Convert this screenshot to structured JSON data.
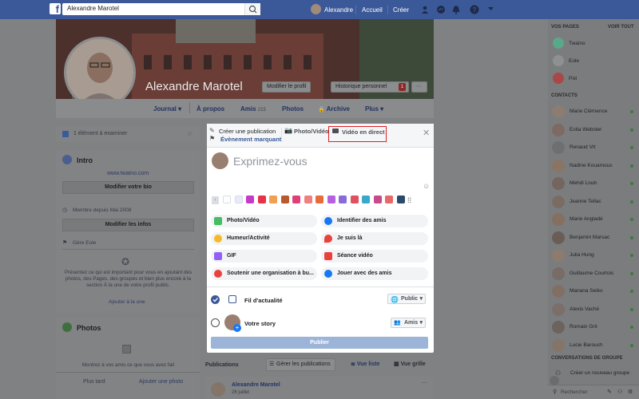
{
  "topbar": {
    "search_value": "Alexandre Marotel",
    "user_name": "Alexandre",
    "home": "Accueil",
    "create": "Créer"
  },
  "cover": {
    "name": "Alexandre Marotel",
    "edit_profile": "Modifier le profil",
    "history": "Historique personnel",
    "history_badge": "1",
    "more": "···"
  },
  "profile_nav": {
    "items": [
      {
        "label": "Journal"
      },
      {
        "label": "À propos"
      },
      {
        "label": "Amis",
        "count": "215"
      },
      {
        "label": "Photos"
      },
      {
        "label": "Archive"
      },
      {
        "label": "Plus"
      }
    ]
  },
  "left": {
    "review": "1 élément à examiner",
    "intro_title": "Intro",
    "intro_link": "www.twaino.com",
    "edit_bio": "Modifier votre bio",
    "member_since": "Membre depuis Mai 2008",
    "edit_info": "Modifier les infos",
    "manages": "Gère Eole",
    "featured_text": "Présentez ce qui est important pour vous en ajoutant des photos, des Pages, des groupes et bien plus encore à la section À la une de votre profil public.",
    "featured_link": "Ajouter à la une",
    "photos_title": "Photos",
    "photos_text": "Montrez à vos amis ce que vous avez fait",
    "photos_more": "Plus tard",
    "photos_add": "Ajouter une photo"
  },
  "posts": {
    "label": "Publications",
    "manage": "Gérer les publications",
    "list_view": "Vue liste",
    "grid_view": "Vue grille",
    "author": "Alexandre Marotel",
    "date": "26 juillet"
  },
  "modal": {
    "tab_create": "Créer une publication",
    "tab_event": "Évènement marquant",
    "tab_photo": "Photo/Vidéo",
    "tab_live": "Vidéo en direct",
    "placeholder": "Exprimez-vous",
    "options": [
      {
        "label": "Photo/Vidéo",
        "color": "#45bd62"
      },
      {
        "label": "Identifier des amis",
        "color": "#1877f2"
      },
      {
        "label": "Humeur/Activité",
        "color": "#f7b928"
      },
      {
        "label": "Je suis là",
        "color": "#e9413b"
      },
      {
        "label": "GIF",
        "color": "#9360f7"
      },
      {
        "label": "Séance vidéo",
        "color": "#e9413b"
      },
      {
        "label": "Soutenir une organisation à bu...",
        "color": "#e9413b"
      },
      {
        "label": "Jouer avec des amis",
        "color": "#1877f2"
      }
    ],
    "feed_label": "Fil d'actualité",
    "feed_privacy": "Public",
    "story_label": "Votre story",
    "story_privacy": "Amis",
    "publish": "Publier",
    "live_highlight_color": "#e02020"
  },
  "sidebar": {
    "pages_title": "VOS PAGES",
    "see_all": "VOIR TOUT",
    "pages": [
      {
        "name": "Twaino"
      },
      {
        "name": "Eole"
      },
      {
        "name": "Pixi"
      }
    ],
    "contacts_title": "CONTACTS",
    "contacts": [
      {
        "name": "Marie Clémence"
      },
      {
        "name": "Estia Webster"
      },
      {
        "name": "Renaud Vrt"
      },
      {
        "name": "Nadine Kouamous"
      },
      {
        "name": "Mehdi Loub"
      },
      {
        "name": "Jeanne Tellac"
      },
      {
        "name": "Marie Angladé"
      },
      {
        "name": "Benjamin Marsac"
      },
      {
        "name": "Julia Hung"
      },
      {
        "name": "Guillaume Courtois"
      },
      {
        "name": "Manana Seiko"
      },
      {
        "name": "Alexis Vaché"
      },
      {
        "name": "Romain Grit"
      },
      {
        "name": "Lucie Barouch"
      }
    ],
    "groups_title": "CONVERSATIONS DE GROUPE",
    "new_group": "Créer un nouveau groupe",
    "search_placeholder": "Rechercher"
  }
}
